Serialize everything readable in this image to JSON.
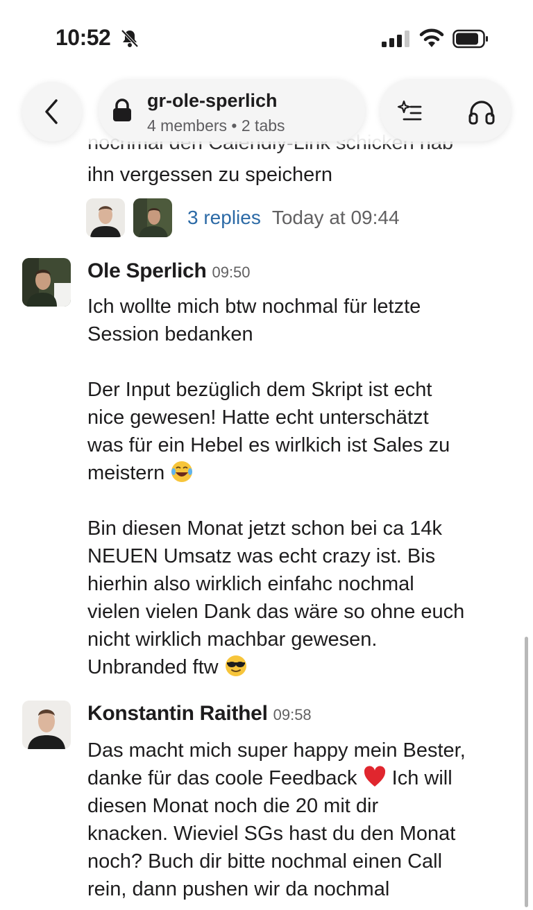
{
  "status_bar": {
    "time": "10:52"
  },
  "header": {
    "channel_name": "gr-ole-sperlich",
    "channel_meta": "4 members • 2 tabs"
  },
  "thread": {
    "clipped_line": "nochmal den Calendly-Link schicken hab",
    "visible_line": "ihn vergessen zu speichern",
    "replies_label": "3 replies",
    "replies_time": "Today at 09:44"
  },
  "messages": [
    {
      "author": "Ole Sperlich",
      "time": "09:50",
      "paragraphs": [
        [
          "Ich wollte mich btw nochmal für letzte",
          "Session bedanken"
        ],
        [
          "Der Input bezüglich dem Skript ist echt",
          "nice gewesen! Hatte echt unterschätzt",
          "was für ein Hebel es wirlkich ist Sales zu",
          "meistern"
        ],
        [
          "Bin diesen Monat jetzt schon bei ca 14k",
          "NEUEN Umsatz was echt crazy ist. Bis",
          "hierhin also wirklich einfahc nochmal",
          "vielen vielen Dank das wäre so ohne euch",
          "nicht wirklich machbar gewesen.",
          "Unbranded ftw"
        ]
      ],
      "emojis": [
        "tears-of-joy-emoji",
        "sunglasses-emoji"
      ]
    },
    {
      "author": "Konstantin Raithel",
      "time": "09:58",
      "lines": [
        "Das macht mich super happy mein Bester,",
        "danke für das coole Feedback",
        "Ich will",
        "diesen Monat noch die 20 mit dir",
        "knacken. Wieviel SGs hast du den Monat",
        "noch? Buch dir bitte nochmal einen Call",
        "rein, dann pushen wir da nochmal"
      ],
      "emojis": [
        "red-heart-emoji"
      ]
    }
  ],
  "colors": {
    "link": "#2c6aa6",
    "timestamp": "#616061",
    "text": "#1d1c1d"
  }
}
